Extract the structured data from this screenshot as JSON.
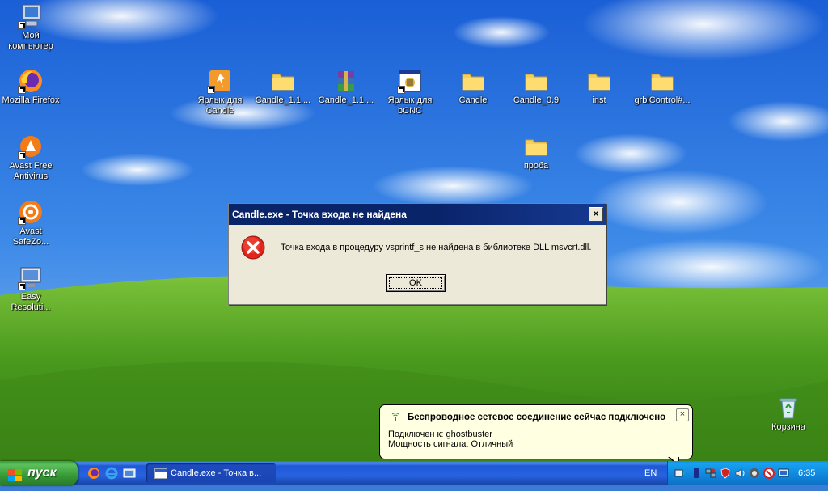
{
  "desktop": {
    "icons": [
      {
        "label": "Мой\nкомпьютер",
        "icon": "my-computer-icon"
      },
      {
        "label": "Mozilla Firefox",
        "icon": "firefox-icon"
      },
      {
        "label": "Avast Free\nAntivirus",
        "icon": "avast-icon"
      },
      {
        "label": "Avast\nSafeZo...",
        "icon": "avast-safezone-icon"
      },
      {
        "label": "Easy\nResoluti...",
        "icon": "easy-resolution-icon"
      },
      {
        "label": "Ярлык для\nCandle",
        "icon": "candle-shortcut-icon"
      },
      {
        "label": "Candle_1.1....",
        "icon": "folder-icon"
      },
      {
        "label": "Candle_1.1....",
        "icon": "winrar-archive-icon"
      },
      {
        "label": "Ярлык для\nbCNC",
        "icon": "bcnc-shortcut-icon"
      },
      {
        "label": "Candle",
        "icon": "folder-icon"
      },
      {
        "label": "Candle_0.9",
        "icon": "folder-icon"
      },
      {
        "label": "inst",
        "icon": "folder-icon"
      },
      {
        "label": "grblControl#...",
        "icon": "folder-icon"
      },
      {
        "label": "проба",
        "icon": "folder-icon"
      },
      {
        "label": "Корзина",
        "icon": "recycle-bin-icon"
      }
    ]
  },
  "dialog": {
    "title": "Candle.exe - Точка входа не найдена",
    "message": "Точка входа в процедуру vsprintf_s не найдена в библиотеке DLL msvcrt.dll.",
    "ok_label": "OK",
    "close_label": "×",
    "icon": "error-icon"
  },
  "balloon": {
    "title": "Беспроводное сетевое соединение сейчас подключено",
    "line1": "Подключен к: ghostbuster",
    "line2": "Мощность сигнала: Отличный",
    "close_label": "×",
    "icon": "wireless-network-icon"
  },
  "taskbar": {
    "start_label": "пуск",
    "quick_launch": [
      "firefox-icon",
      "internet-explorer-icon",
      "show-desktop-icon"
    ],
    "task_label": "Candle.exe - Точка в...",
    "language": "EN",
    "tray_icons": [
      "wireless-network-icon",
      "usb-icon",
      "network-icon",
      "shield-icon",
      "volume-icon",
      "avast-icon",
      "security-alert-icon",
      "monitor-icon"
    ],
    "clock": "6:35"
  },
  "colors": {
    "title_bar": "#0a246a",
    "dialog_bg": "#ece9d8",
    "taskbar": "#245edb",
    "start_button": "#3c9a3c",
    "balloon_bg": "#ffffe1"
  }
}
